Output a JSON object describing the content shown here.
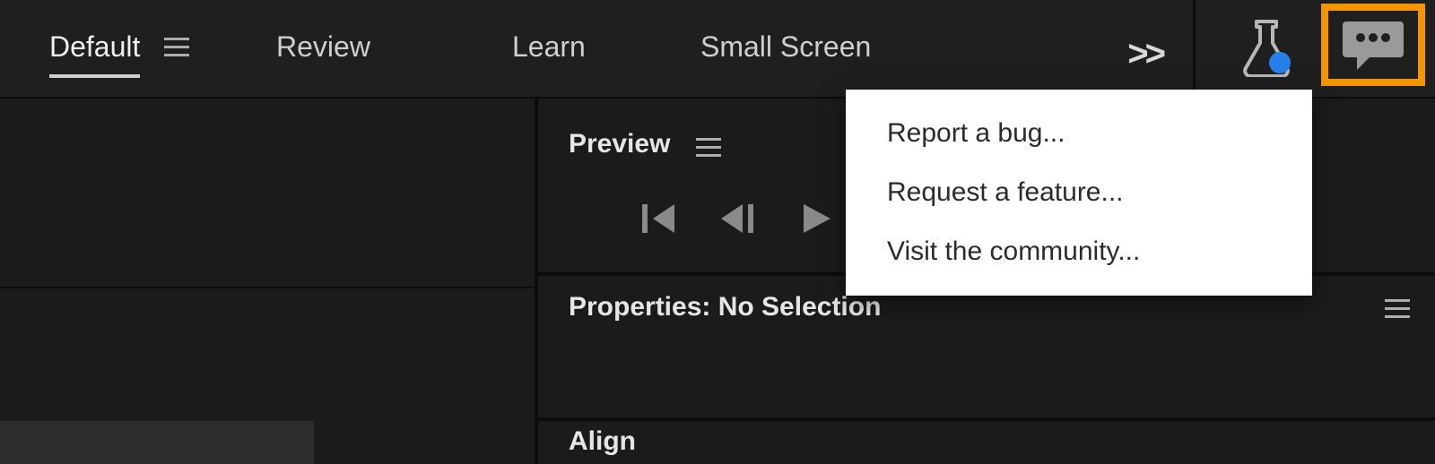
{
  "workspaces": {
    "default": "Default",
    "review": "Review",
    "learn": "Learn",
    "small_screen": "Small Screen"
  },
  "overflow_glyph": ">>",
  "preview": {
    "title": "Preview"
  },
  "properties": {
    "title": "Properties: No Selection"
  },
  "align": {
    "title": "Align"
  },
  "feedback_menu": {
    "report_bug": "Report a bug...",
    "request_feature": "Request a feature...",
    "visit_community": "Visit the community..."
  }
}
